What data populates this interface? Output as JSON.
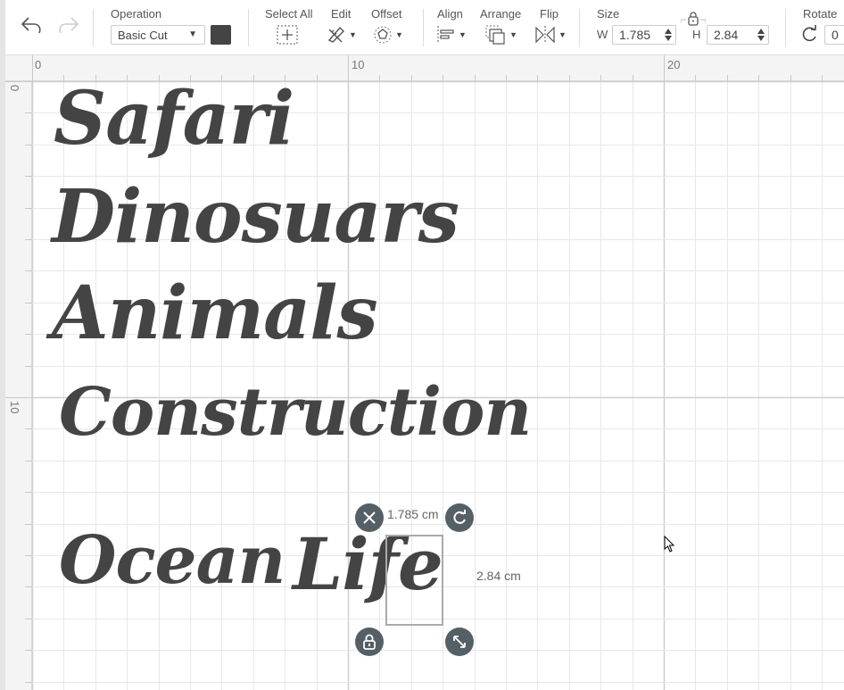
{
  "toolbar": {
    "undo_icon": "undo-icon",
    "redo_icon": "redo-icon",
    "operation": {
      "label": "Operation",
      "value": "Basic Cut",
      "color": "#444444"
    },
    "select_all": {
      "label": "Select All",
      "icon": "select-all-icon"
    },
    "edit": {
      "label": "Edit",
      "icon": "pencil-ruler-icon"
    },
    "offset": {
      "label": "Offset",
      "icon": "offset-icon"
    },
    "align": {
      "label": "Align",
      "icon": "align-icon"
    },
    "arrange": {
      "label": "Arrange",
      "icon": "arrange-icon"
    },
    "flip": {
      "label": "Flip",
      "icon": "flip-icon"
    },
    "size": {
      "label": "Size",
      "w_label": "W",
      "w_value": "1.785",
      "h_label": "H",
      "h_value": "2.84",
      "lock_icon": "lock-icon"
    },
    "rotate": {
      "label": "Rotate",
      "value": "0",
      "icon": "rotate-icon"
    }
  },
  "rulers": {
    "horizontal": [
      "0",
      "10",
      "20"
    ],
    "vertical": [
      "0",
      "10"
    ]
  },
  "canvas": {
    "words": [
      "Safari",
      "Dinosuars",
      "Animals",
      "Construction",
      "Ocean",
      "Life"
    ],
    "selection": {
      "width_label": "1.785 cm",
      "height_label": "2.84 cm",
      "handles": [
        "close-icon",
        "rotate-icon",
        "lock-icon",
        "resize-icon"
      ]
    }
  }
}
